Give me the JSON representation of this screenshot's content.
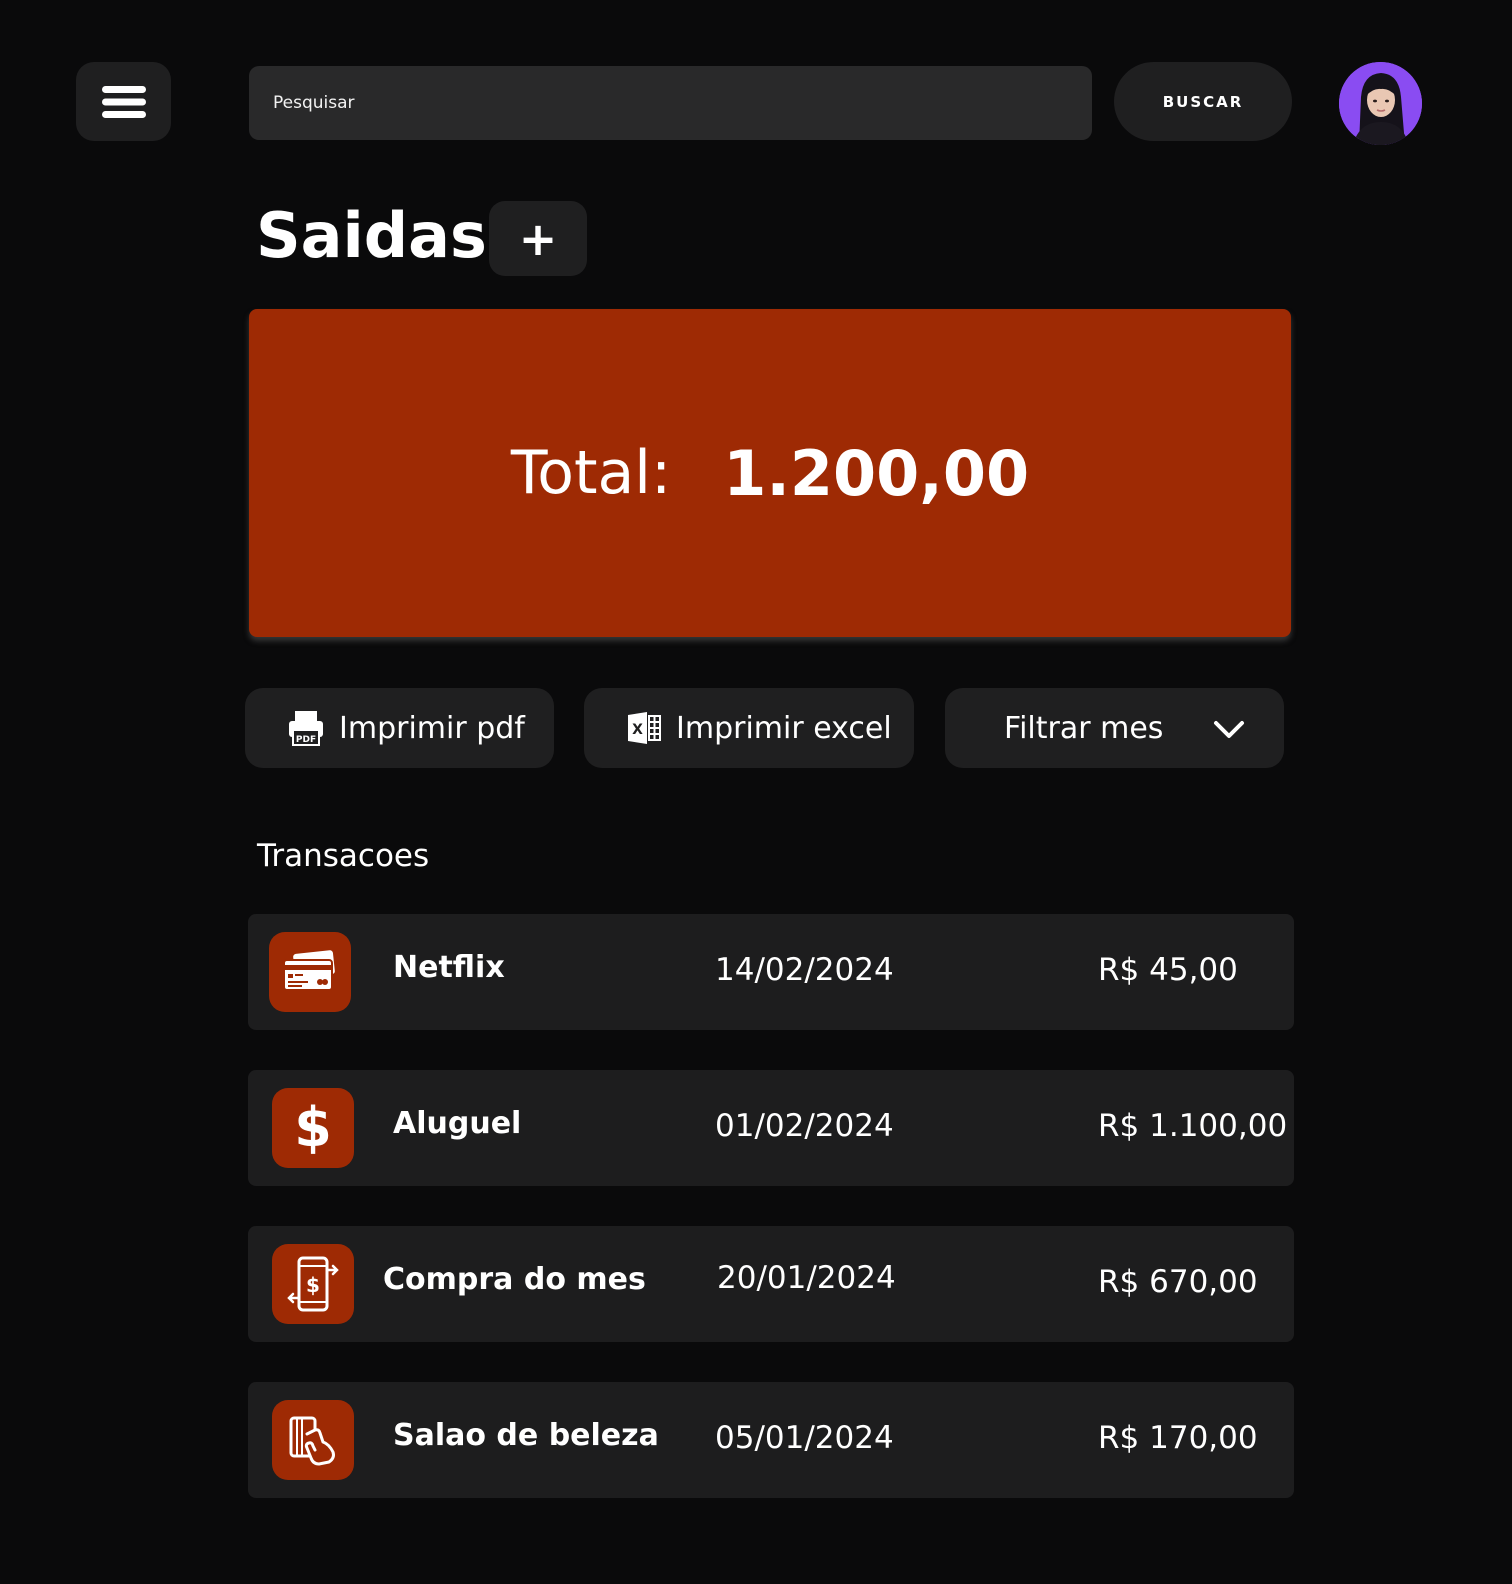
{
  "header": {
    "search_placeholder": "Pesquisar",
    "search_button_label": "BUSCAR",
    "menu_icon": "hamburger-icon",
    "avatar": "user-avatar"
  },
  "page": {
    "title": "Saidas",
    "add_label": "+"
  },
  "summary": {
    "total_label": "Total:",
    "total_value": "1.200,00",
    "accent_color": "#9e2a04"
  },
  "actions": {
    "print_pdf": "Imprimir pdf",
    "print_excel": "Imprimir excel",
    "filter_month": "Filtrar mes",
    "pdf_icon_text": "PDF",
    "excel_icon_text": "X"
  },
  "transactions": {
    "title": "Transacoes",
    "items": [
      {
        "name": "Netflix",
        "date": "14/02/2024",
        "value": "R$ 45,00",
        "icon": "credit-card-icon"
      },
      {
        "name": "Aluguel",
        "date": "01/02/2024",
        "value": "R$ 1.100,00",
        "icon": "dollar-icon"
      },
      {
        "name": "Compra do mes",
        "date": "20/01/2024",
        "value": "R$ 670,00",
        "icon": "mobile-payment-icon"
      },
      {
        "name": "Salao de beleza",
        "date": "05/01/2024",
        "value": "R$ 170,00",
        "icon": "card-tap-icon"
      }
    ]
  },
  "colors": {
    "background": "#0a0a0b",
    "surface": "#1f1f20",
    "accent": "#9e2a04",
    "avatar_bg": "#8a4cf2"
  }
}
